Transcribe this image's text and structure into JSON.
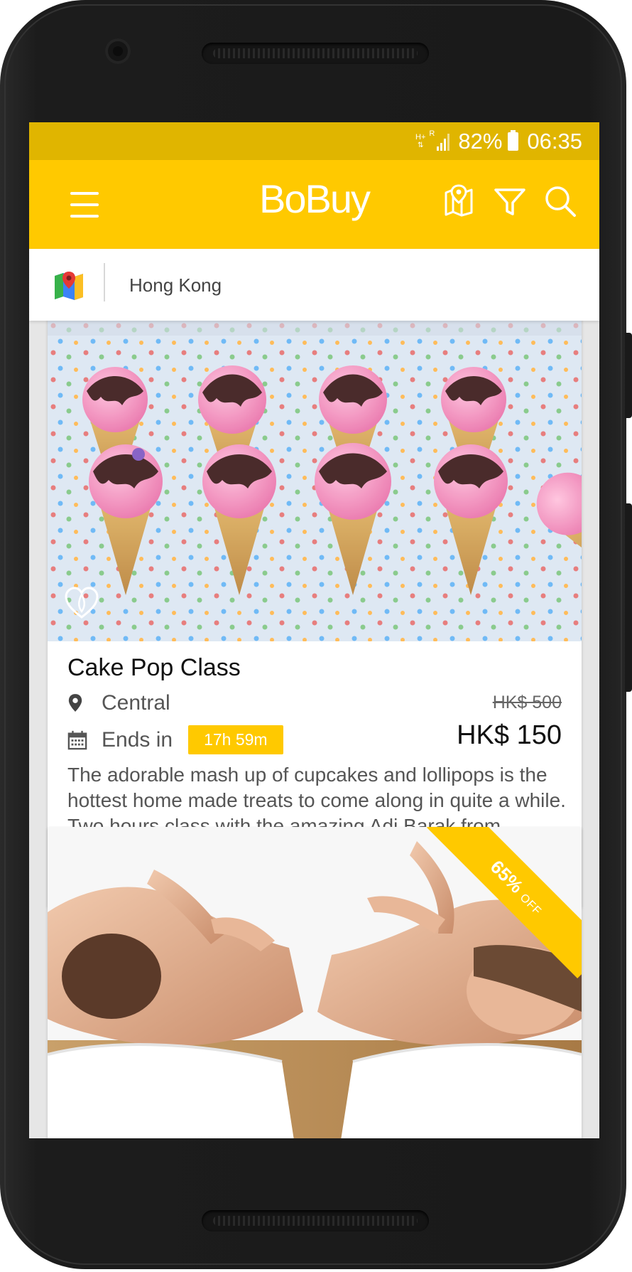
{
  "status_bar": {
    "network": "H+",
    "roaming": "R",
    "battery": "82%",
    "time": "06:35"
  },
  "app_bar": {
    "title": "BoBuy"
  },
  "location": {
    "city": "Hong Kong"
  },
  "deals": [
    {
      "title": "Cake Pop Class",
      "location": "Central",
      "ends_label": "Ends in",
      "timer": "17h 59m",
      "original_price": "HK$ 500",
      "price": "HK$ 150",
      "description": "The adorable mash up of cupcakes and lollipops is the hottest home made treats to come along in quite a while. Two hours class with the amazing Adi Barak from ab_cake will show you how you can show off at your next party."
    },
    {
      "discount": "65%",
      "discount_suffix": "OFF"
    }
  ],
  "colors": {
    "accent": "#ffc900",
    "status_bar": "#e0b500"
  },
  "icons": [
    "menu-icon",
    "map-icon",
    "filter-icon",
    "search-icon",
    "maps-app-icon",
    "heart-icon",
    "pin-icon",
    "calendar-icon"
  ]
}
